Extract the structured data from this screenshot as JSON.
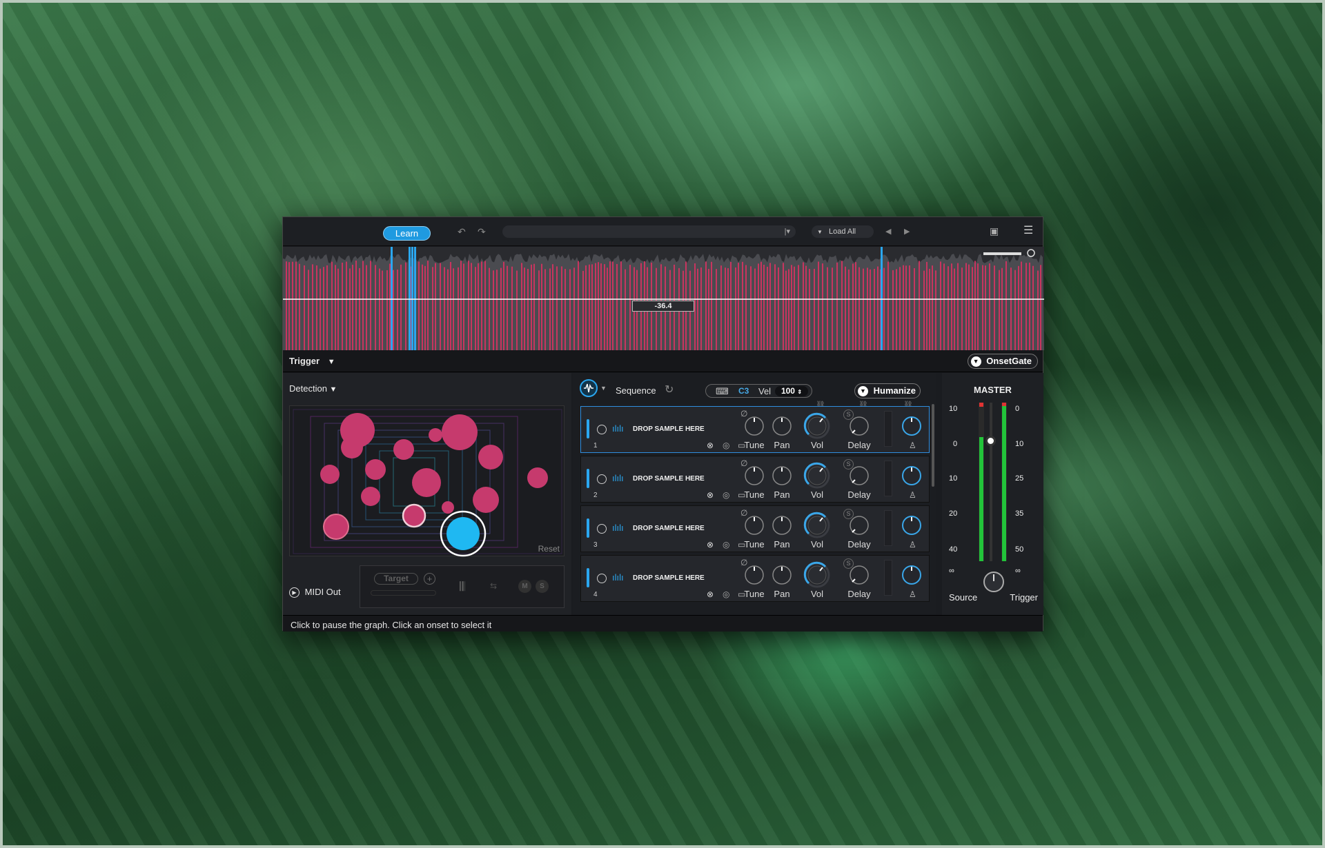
{
  "toolbar": {
    "learn_label": "Learn",
    "preset_value": "",
    "load_all_label": "Load All"
  },
  "waveform": {
    "threshold_value": "-36.4",
    "accent_color": "#c8355f",
    "selected_color": "#2aa7f0"
  },
  "trigger": {
    "title": "Trigger",
    "module_label": "OnsetGate"
  },
  "detection": {
    "title": "Detection",
    "reset_label": "Reset",
    "midi_out_label": "MIDI Out",
    "target_label": "Target",
    "mute_label": "M",
    "solo_label": "S"
  },
  "sampler": {
    "sequence_label": "Sequence",
    "note": "C3",
    "vel_label": "Vel",
    "vel_value": "100",
    "humanize_label": "Humanize",
    "slots": [
      {
        "num": "1",
        "text": "DROP SAMPLE HERE",
        "tune": "Tune",
        "pan": "Pan",
        "vol": "Vol",
        "delay": "Delay",
        "solo": "S"
      },
      {
        "num": "2",
        "text": "DROP SAMPLE HERE",
        "tune": "Tune",
        "pan": "Pan",
        "vol": "Vol",
        "delay": "Delay",
        "solo": "S"
      },
      {
        "num": "3",
        "text": "DROP SAMPLE HERE",
        "tune": "Tune",
        "pan": "Pan",
        "vol": "Vol",
        "delay": "Delay",
        "solo": "S"
      },
      {
        "num": "4",
        "text": "DROP SAMPLE HERE",
        "tune": "Tune",
        "pan": "Pan",
        "vol": "Vol",
        "delay": "Delay",
        "solo": "S"
      }
    ]
  },
  "master": {
    "title": "MASTER",
    "left_scale": [
      "10",
      "0",
      "10",
      "20",
      "40",
      "∞"
    ],
    "right_scale": [
      "0",
      "10",
      "25",
      "35",
      "50",
      "∞"
    ],
    "source_label": "Source",
    "trigger_label": "Trigger"
  },
  "status": {
    "text": "Click to pause the graph. Click an onset to select it"
  }
}
